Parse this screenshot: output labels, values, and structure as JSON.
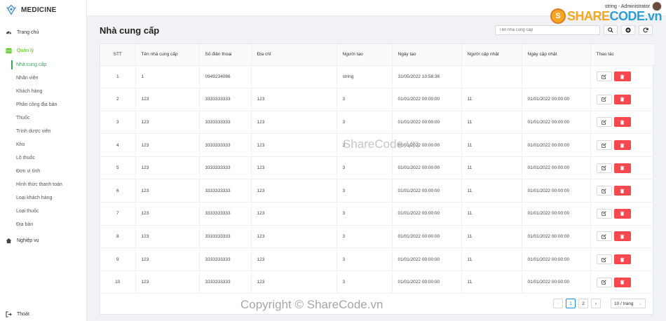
{
  "app": {
    "title": "MEDICINE"
  },
  "header": {
    "user_text": "string - Administrator"
  },
  "watermark": {
    "top_logo_share": "SHARE",
    "top_logo_code": "CODE.vn",
    "logo_glyph": "S",
    "middle": "ShareCode.vn",
    "bottom": "Copyright © ShareCode.vn"
  },
  "sidebar": {
    "home": {
      "label": "Trang chủ",
      "icon": "dashboard-icon"
    },
    "manage": {
      "label": "Quản lý",
      "icon": "table-icon"
    },
    "sub_items": [
      {
        "label": "Nhà cung cấp",
        "active": true
      },
      {
        "label": "Nhân viên"
      },
      {
        "label": "Khách hàng"
      },
      {
        "label": "Phân công địa bàn"
      },
      {
        "label": "Thuốc"
      },
      {
        "label": "Trình dược viên"
      },
      {
        "label": "Kho"
      },
      {
        "label": "Lô thuốc"
      },
      {
        "label": "Đơn vị tính"
      },
      {
        "label": "Hình thức thanh toán"
      },
      {
        "label": "Loại khách hàng"
      },
      {
        "label": "Loại thuốc"
      },
      {
        "label": "Địa bàn"
      }
    ],
    "business": {
      "label": "Nghiệp vụ",
      "icon": "home-icon"
    },
    "logout": {
      "label": "Thoát",
      "icon": "logout-icon"
    }
  },
  "page": {
    "title": "Nhà cung cấp",
    "search_placeholder": "Tên nhà cung cấp"
  },
  "table": {
    "columns": [
      "STT",
      "Tên nhà cung cấp",
      "Số điện thoại",
      "Địa chỉ",
      "Người tạo",
      "Ngày tạo",
      "Người cập nhật",
      "Ngày cập nhật",
      "Thao tác"
    ],
    "rows": [
      [
        "1",
        "1",
        "0949234086",
        "",
        "string",
        "31/05/2022 10:58:36",
        "",
        ""
      ],
      [
        "2",
        "123",
        "3333333333",
        "123",
        "3",
        "01/01/2022 00:00:00",
        "11",
        "01/01/2022 00:00:00"
      ],
      [
        "3",
        "123",
        "3333333333",
        "123",
        "3",
        "01/01/2022 00:00:00",
        "11",
        "01/01/2022 00:00:00"
      ],
      [
        "4",
        "123",
        "3333333333",
        "123",
        "3",
        "01/01/2022 00:00:00",
        "11",
        "01/01/2022 00:00:00"
      ],
      [
        "5",
        "123",
        "3333333333",
        "123",
        "3",
        "01/01/2022 00:00:00",
        "11",
        "01/01/2022 00:00:00"
      ],
      [
        "6",
        "123",
        "3333333333",
        "123",
        "3",
        "01/01/2022 00:00:00",
        "11",
        "01/01/2022 00:00:00"
      ],
      [
        "7",
        "123",
        "3333333333",
        "123",
        "3",
        "01/01/2022 00:00:00",
        "11",
        "01/01/2022 00:00:00"
      ],
      [
        "8",
        "123",
        "3333333333",
        "123",
        "3",
        "01/01/2022 00:00:00",
        "11",
        "01/01/2022 00:00:00"
      ],
      [
        "9",
        "123",
        "3333333333",
        "123",
        "3",
        "01/01/2022 00:00:00",
        "11",
        "01/01/2022 00:00:00"
      ],
      [
        "10",
        "123",
        "3333333333",
        "123",
        "3",
        "01/01/2022 00:00:00",
        "11",
        "01/01/2022 00:00:00"
      ]
    ]
  },
  "pagination": {
    "prev": "‹",
    "next": "›",
    "pages": [
      "1",
      "2"
    ],
    "current": "1",
    "page_size": "10 / trang"
  },
  "colors": {
    "accent": "#3aa35a",
    "danger": "#f5484f",
    "active_page": "#1890ff"
  }
}
